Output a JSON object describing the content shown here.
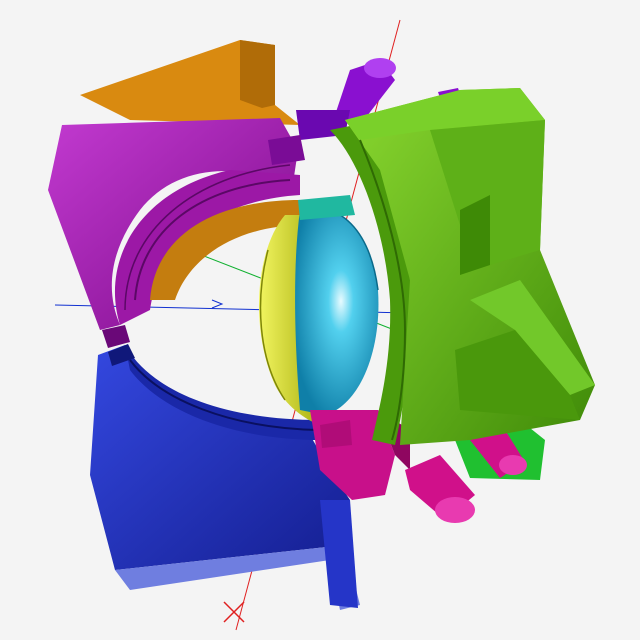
{
  "viewport": {
    "background": "#f4f4f4",
    "axes": {
      "x_axis_color": "#e02020",
      "y_axis_color": "#10b030",
      "z_axis_color": "#1030d0"
    }
  },
  "parts": [
    {
      "name": "upper-left-bracket",
      "color": "#a020a8",
      "accent": "#d98a10"
    },
    {
      "name": "lower-left-bracket",
      "color": "#2030c0",
      "accent": "#6f7ee0"
    },
    {
      "name": "right-bracket",
      "color": "#5aaa10"
    },
    {
      "name": "center-lens",
      "color": "#20b0d8"
    },
    {
      "name": "yellow-ring",
      "color": "#d8e020"
    },
    {
      "name": "top-pin",
      "color": "#8a10d0"
    },
    {
      "name": "bottom-pin",
      "color": "#d0108a"
    },
    {
      "name": "bottom-clamp",
      "color": "#d0108a"
    },
    {
      "name": "green-block",
      "color": "#20c030"
    }
  ]
}
